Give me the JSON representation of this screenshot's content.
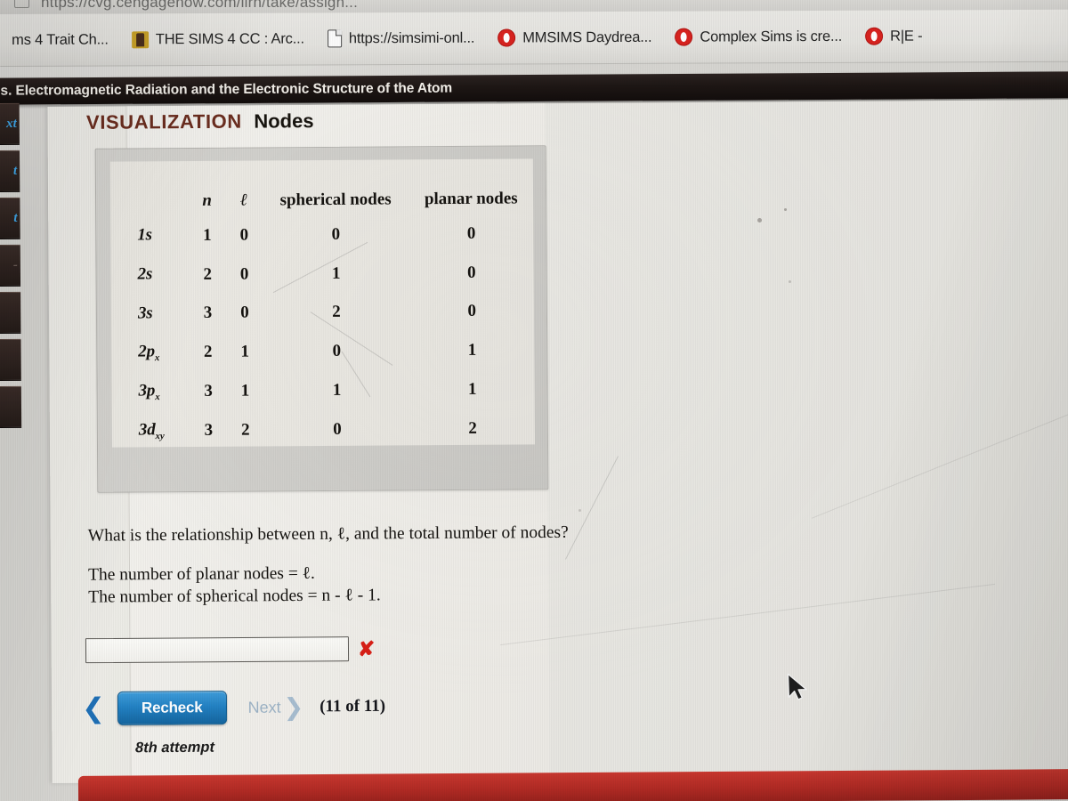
{
  "browser": {
    "url": "https://cvg.cengagenow.com/ilrn/take/assign...",
    "url_icon": "tab-icon",
    "bookmarks": [
      {
        "label": "ms 4 Trait Ch...",
        "icon": "none"
      },
      {
        "label": "THE SIMS 4 CC : Arc...",
        "icon": "sims-favicon"
      },
      {
        "label": "https://simsimi-onl...",
        "icon": "document-favicon"
      },
      {
        "label": "MMSIMS Daydrea...",
        "icon": "opera-favicon"
      },
      {
        "label": "Complex Sims is cre...",
        "icon": "opera-favicon"
      },
      {
        "label": "R|E -",
        "icon": "opera-favicon"
      }
    ]
  },
  "course": {
    "header_title": "es. Electromagnetic Radiation and the Electronic Structure of the Atom"
  },
  "sidebar": {
    "items": [
      {
        "label": "xt"
      },
      {
        "label": "t"
      },
      {
        "label": "t"
      },
      {
        "label": "-"
      },
      {
        "label": ""
      },
      {
        "label": ""
      },
      {
        "label": ""
      }
    ]
  },
  "visualization": {
    "kicker": "VISUALIZATION",
    "title": "Nodes",
    "kicker_color": "#6b2d1f"
  },
  "chart_data": {
    "type": "table",
    "title": "Nodes",
    "columns": [
      "",
      "n",
      "ℓ",
      "spherical nodes",
      "planar nodes"
    ],
    "rows": [
      {
        "orbital": "1s",
        "orbital_base": "1s",
        "orbital_sub": "",
        "n": "1",
        "l": "0",
        "spherical_nodes": "0",
        "planar_nodes": "0"
      },
      {
        "orbital": "2s",
        "orbital_base": "2s",
        "orbital_sub": "",
        "n": "2",
        "l": "0",
        "spherical_nodes": "1",
        "planar_nodes": "0"
      },
      {
        "orbital": "3s",
        "orbital_base": "3s",
        "orbital_sub": "",
        "n": "3",
        "l": "0",
        "spherical_nodes": "2",
        "planar_nodes": "0"
      },
      {
        "orbital": "2px",
        "orbital_base": "2p",
        "orbital_sub": "x",
        "n": "2",
        "l": "1",
        "spherical_nodes": "0",
        "planar_nodes": "1"
      },
      {
        "orbital": "3px",
        "orbital_base": "3p",
        "orbital_sub": "x",
        "n": "3",
        "l": "1",
        "spherical_nodes": "1",
        "planar_nodes": "1"
      },
      {
        "orbital": "3dxy",
        "orbital_base": "3d",
        "orbital_sub": "xy",
        "n": "3",
        "l": "2",
        "spherical_nodes": "0",
        "planar_nodes": "2"
      }
    ]
  },
  "question": {
    "prompt": "What is the relationship between n, ℓ, and the total number of nodes?",
    "answer_lines": [
      "The number of planar nodes = ℓ.",
      "The number of spherical nodes = n - ℓ - 1."
    ],
    "input_value": "",
    "input_placeholder": "",
    "result_mark": "✘",
    "result_color": "#d81f16"
  },
  "controls": {
    "prev_icon": "chevron-left-icon",
    "recheck_label": "Recheck",
    "next_label": "Next",
    "next_icon": "chevron-right-icon",
    "counter": "(11 of 11)",
    "attempt": "8th attempt",
    "accent_blue": "#2382c4",
    "bottom_bar_color": "#b02a24"
  },
  "cursor": {
    "icon": "mouse-pointer-icon"
  }
}
